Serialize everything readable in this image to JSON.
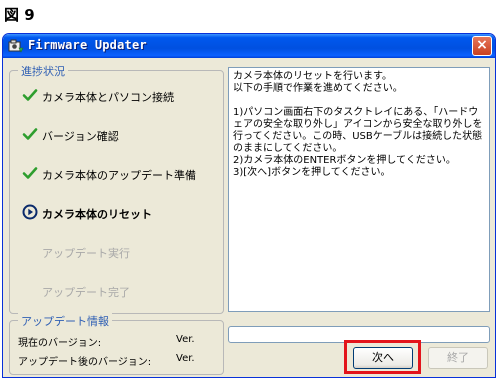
{
  "figure_label": "図 9",
  "window": {
    "title": "Firmware Updater",
    "close_label": "×"
  },
  "progress_group": {
    "label": "進捗状況",
    "steps": [
      {
        "label": "カメラ本体とパソコン接続",
        "state": "done"
      },
      {
        "label": "バージョン確認",
        "state": "done"
      },
      {
        "label": "カメラ本体のアップデート準備",
        "state": "done"
      },
      {
        "label": "カメラ本体のリセット",
        "state": "current"
      },
      {
        "label": "アップデート実行",
        "state": "pending"
      },
      {
        "label": "アップデート完了",
        "state": "pending"
      }
    ]
  },
  "instructions": "カメラ本体のリセットを行います。\n以下の手順で作業を進めてください。\n\n1)パソコン画面右下のタスクトレイにある、「ハードウェアの安全な取り外し」アイコンから安全な取り外しを行ってください。この時、USBケーブルは接続した状態のままにしてください。\n2)カメラ本体のENTERボタンを押してください。\n3)[次へ]ボタンを押してください。",
  "update_info": {
    "label": "アップデート情報",
    "current_version_label": "現在のバージョン:",
    "current_version_value": "Ver.",
    "new_version_label": "アップデート後のバージョン:",
    "new_version_value": "Ver."
  },
  "progress_bar_value": 0,
  "buttons": {
    "next": "次へ",
    "finish": "終了"
  },
  "colors": {
    "check_green": "#2e9e2e",
    "current_step": "#0a2a6b",
    "highlight_red": "#e3141b"
  }
}
